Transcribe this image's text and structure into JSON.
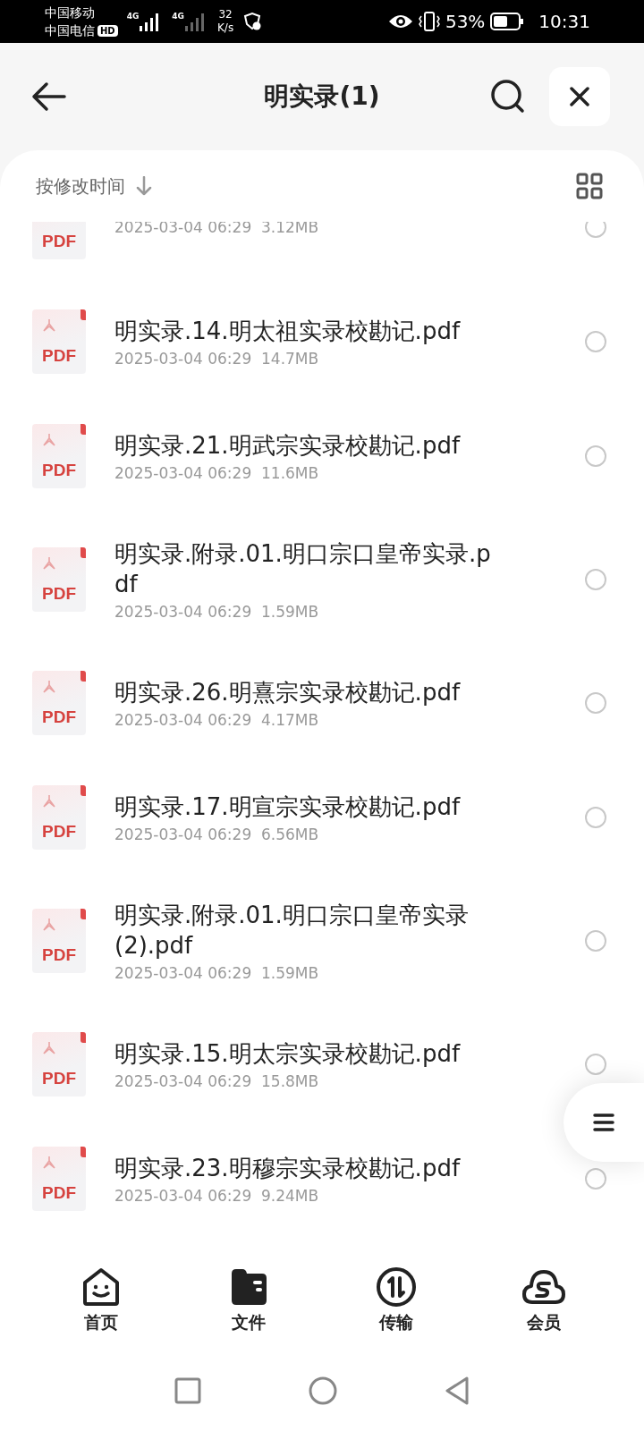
{
  "status_bar": {
    "carrier_1": "中国移动",
    "carrier_2": "中国电信",
    "hd": "HD",
    "network_1": "4G",
    "network_2": "4G",
    "speed_value": "32",
    "speed_unit": "K/s",
    "battery": "53%",
    "time": "10:31"
  },
  "header": {
    "title": "明实录(1)"
  },
  "sort": {
    "label": "按修改时间"
  },
  "files": [
    {
      "meta": "2025-03-04 06:29  3.12MB",
      "badge": "PDF",
      "selected": false
    },
    {
      "title": "明实录.14.明太祖实录校勘记.pdf",
      "meta": "2025-03-04 06:29  14.7MB",
      "badge": "PDF",
      "selected": false
    },
    {
      "title": "明实录.21.明武宗实录校勘记.pdf",
      "meta": "2025-03-04 06:29  11.6MB",
      "badge": "PDF",
      "selected": false
    },
    {
      "title": "明实录.附录.01.明口宗口皇帝实录.pdf",
      "meta": "2025-03-04 06:29  1.59MB",
      "badge": "PDF",
      "selected": false
    },
    {
      "title": "明实录.26.明熹宗实录校勘记.pdf",
      "meta": "2025-03-04 06:29  4.17MB",
      "badge": "PDF",
      "selected": false
    },
    {
      "title": "明实录.17.明宣宗实录校勘记.pdf",
      "meta": "2025-03-04 06:29  6.56MB",
      "badge": "PDF",
      "selected": false
    },
    {
      "title": "明实录.附录.01.明口宗口皇帝实录 (2).pdf",
      "meta": "2025-03-04 06:29  1.59MB",
      "badge": "PDF",
      "selected": false
    },
    {
      "title": "明实录.15.明太宗实录校勘记.pdf",
      "meta": "2025-03-04 06:29  15.8MB",
      "badge": "PDF",
      "selected": false
    },
    {
      "title": "明实录.23.明穆宗实录校勘记.pdf",
      "meta": "2025-03-04 06:29  9.24MB",
      "badge": "PDF",
      "selected": false
    }
  ],
  "bottom_nav": [
    {
      "kind": "home",
      "label": "首页",
      "selected": false
    },
    {
      "kind": "files",
      "label": "文件",
      "selected": true
    },
    {
      "kind": "transfer",
      "label": "传输",
      "selected": false
    },
    {
      "kind": "vip",
      "label": "会员",
      "selected": false
    }
  ]
}
